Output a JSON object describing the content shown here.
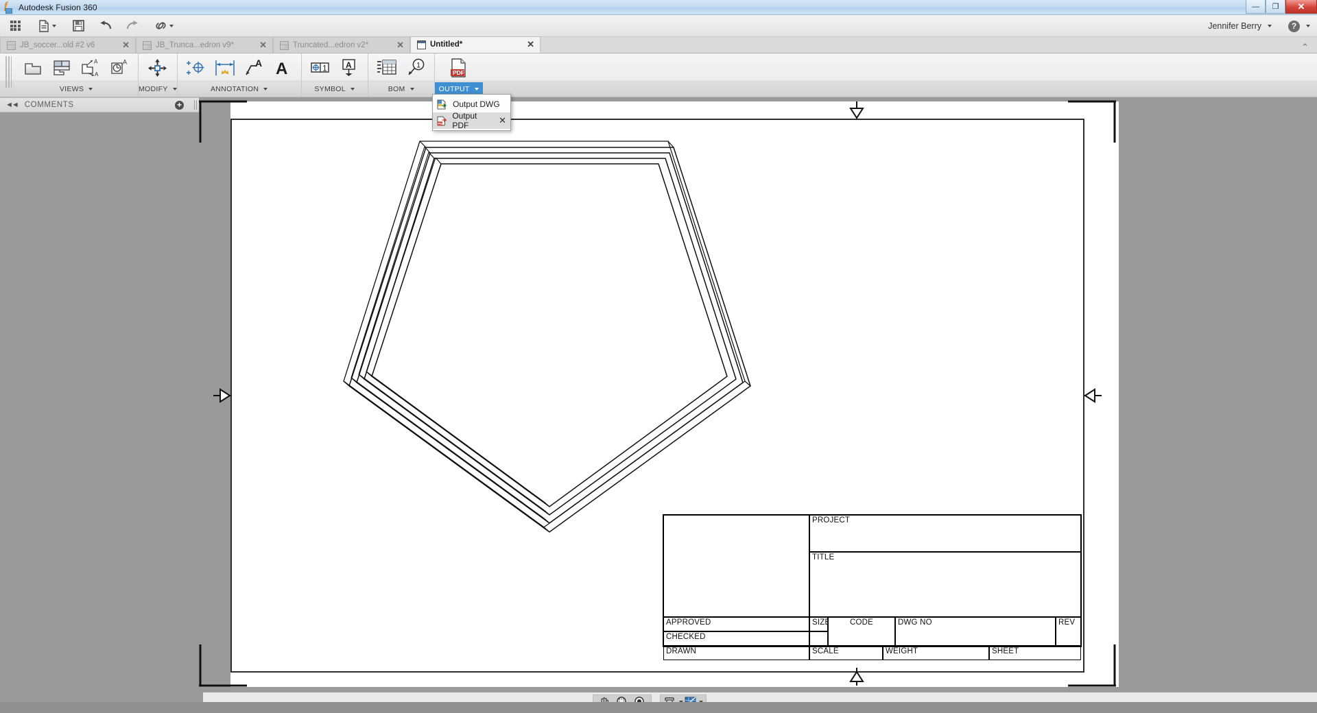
{
  "window": {
    "title": "Autodesk Fusion 360",
    "app_icon": "fusion-logo-icon",
    "controls": {
      "minimize": "—",
      "maximize": "❐",
      "close": "✕"
    }
  },
  "quick_access": {
    "items": [
      {
        "name": "show-data-panel",
        "icon": "grid-icon",
        "label": ""
      },
      {
        "name": "file-menu",
        "icon": "file-icon",
        "label": "",
        "caret": true
      },
      {
        "name": "save",
        "icon": "save-icon",
        "label": ""
      },
      {
        "name": "undo",
        "icon": "undo-arrow-icon",
        "label": ""
      },
      {
        "name": "redo",
        "icon": "redo-arrow-icon",
        "label": ""
      },
      {
        "name": "link-menu",
        "icon": "link-icon",
        "label": "",
        "caret": true
      }
    ],
    "user_name": "Jennifer Berry",
    "help_label": "?"
  },
  "tabs": [
    {
      "label": "JB_soccer...old #2 v6",
      "active": false,
      "close": "✕",
      "icon": "cube-icon"
    },
    {
      "label": "JB_Trunca...edron v9*",
      "active": false,
      "close": "✕",
      "icon": "cube-icon"
    },
    {
      "label": "Truncated...edron v2*",
      "active": false,
      "close": "✕",
      "icon": "cube-icon"
    },
    {
      "label": "Untitled*",
      "active": true,
      "close": "✕",
      "icon": "drawing-icon"
    }
  ],
  "tabbar_overflow": "⌃",
  "ribbon": {
    "groups": [
      {
        "label": "VIEWS",
        "active": false,
        "buttons": [
          {
            "name": "base-view-icon",
            "tip": "Base View"
          },
          {
            "name": "projected-view-icon",
            "tip": "Projected View"
          },
          {
            "name": "auxiliary-view-icon",
            "tip": "Auxiliary View"
          },
          {
            "name": "detail-view-icon",
            "tip": "Detail View"
          }
        ]
      },
      {
        "label": "MODIFY",
        "active": false,
        "buttons": [
          {
            "name": "move-view-icon",
            "tip": "Move/Edit View"
          }
        ]
      },
      {
        "label": "ANNOTATION",
        "active": false,
        "buttons": [
          {
            "name": "centermark-icon",
            "tip": "Centerline / Center Mark"
          },
          {
            "name": "dimension-icon",
            "tip": "Dimension"
          },
          {
            "name": "leader-text-icon",
            "tip": "Leader Text"
          },
          {
            "name": "text-icon",
            "tip": "Text"
          }
        ]
      },
      {
        "label": "SYMBOL",
        "active": false,
        "buttons": [
          {
            "name": "feature-control-frame-icon",
            "tip": "Feature Control Frame"
          },
          {
            "name": "surface-texture-icon",
            "tip": "Surface Texture"
          }
        ]
      },
      {
        "label": "BOM",
        "active": false,
        "buttons": [
          {
            "name": "table-icon",
            "tip": "Table"
          },
          {
            "name": "balloon-icon",
            "tip": "Balloon",
            "badge": "1"
          }
        ]
      },
      {
        "label": "OUTPUT",
        "active": true,
        "buttons": [
          {
            "name": "output-pdf-icon",
            "tip": "Output PDF",
            "badge": "PDF"
          }
        ]
      }
    ]
  },
  "output_menu": {
    "open": true,
    "items": [
      {
        "label": "Output DWG",
        "icon": "dwg-export-icon",
        "highlighted": false,
        "close": ""
      },
      {
        "label": "Output PDF",
        "icon": "pdf-export-icon",
        "highlighted": true,
        "close": "✕"
      }
    ]
  },
  "comments_panel": {
    "title": "COMMENTS",
    "collapse_glyph": "◄◄",
    "add_glyph": "+"
  },
  "drawing": {
    "shape_name": "pentagon-frame-view",
    "sheet_markers": [
      "top-center-arrow",
      "left-center-arrow",
      "right-center-arrow",
      "bottom-center-arrow"
    ],
    "title_block": {
      "cells": [
        {
          "name": "logo-cell",
          "label": ""
        },
        {
          "name": "project-cell",
          "label": "PROJECT",
          "align": "left"
        },
        {
          "name": "title-cell",
          "label": "TITLE",
          "align": "left"
        },
        {
          "name": "approved-cell",
          "label": "APPROVED",
          "align": "left"
        },
        {
          "name": "checked-cell",
          "label": "CHECKED",
          "align": "left"
        },
        {
          "name": "drawn-cell",
          "label": "DRAWN",
          "align": "left"
        },
        {
          "name": "size-cell",
          "label": "SIZE",
          "align": "left"
        },
        {
          "name": "size-value-cell",
          "label": "",
          "align": "left"
        },
        {
          "name": "code-cell",
          "label": "CODE",
          "align": "center"
        },
        {
          "name": "dwgno-cell",
          "label": "DWG NO",
          "align": "left"
        },
        {
          "name": "rev-cell",
          "label": "REV",
          "align": "left"
        },
        {
          "name": "scale-cell",
          "label": "SCALE",
          "align": "left"
        },
        {
          "name": "weight-cell",
          "label": "WEIGHT",
          "align": "left"
        },
        {
          "name": "sheet-cell",
          "label": "SHEET",
          "align": "left"
        }
      ]
    }
  },
  "navigation_bar": {
    "group1": [
      {
        "name": "pan-icon",
        "tip": "Pan"
      },
      {
        "name": "zoom-window-icon",
        "tip": "Zoom Window"
      },
      {
        "name": "zoom-fit-icon",
        "tip": "Fit"
      }
    ],
    "group2": [
      {
        "name": "display-settings-icon",
        "tip": "Display Settings",
        "caret": true
      },
      {
        "name": "grid-snaps-icon",
        "tip": "Grid and Snaps",
        "caret": true
      }
    ]
  },
  "colors": {
    "accent_blue": "#3f8fd2",
    "titlebar_blue": "#b6d3ec",
    "canvas_gray": "#9a9a9a",
    "ribbon_gray": "#ededed",
    "close_red": "#d4453c",
    "pdf_red": "#c5362c"
  }
}
